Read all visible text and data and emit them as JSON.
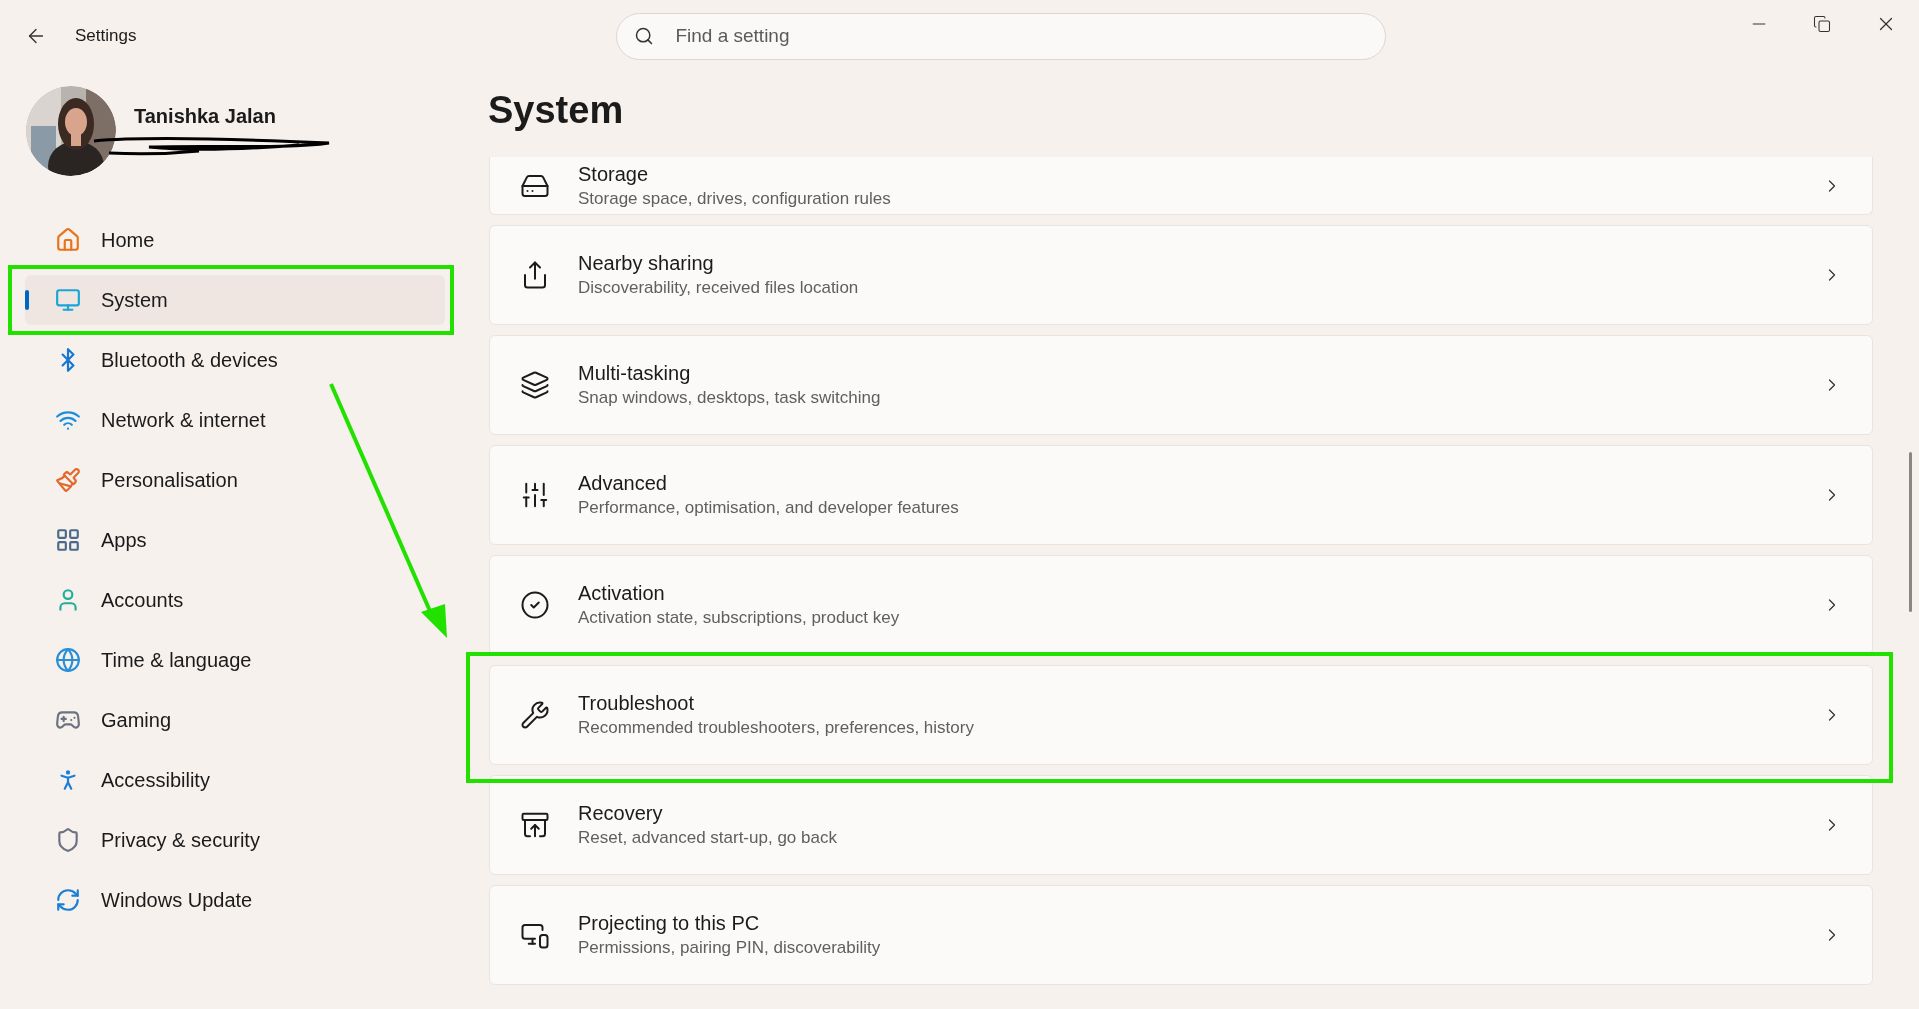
{
  "window": {
    "title": "Settings"
  },
  "search": {
    "placeholder": "Find a setting"
  },
  "account": {
    "name": "Tanishka Jalan"
  },
  "sidebar": {
    "items": [
      {
        "label": "Home",
        "kind": "home",
        "selected": false,
        "highlighted": false
      },
      {
        "label": "System",
        "kind": "system",
        "selected": true,
        "highlighted": true
      },
      {
        "label": "Bluetooth & devices",
        "kind": "bluetooth",
        "selected": false,
        "highlighted": false
      },
      {
        "label": "Network & internet",
        "kind": "wifi",
        "selected": false,
        "highlighted": false
      },
      {
        "label": "Personalisation",
        "kind": "brush",
        "selected": false,
        "highlighted": false
      },
      {
        "label": "Apps",
        "kind": "apps",
        "selected": false,
        "highlighted": false
      },
      {
        "label": "Accounts",
        "kind": "person",
        "selected": false,
        "highlighted": false
      },
      {
        "label": "Time & language",
        "kind": "globe",
        "selected": false,
        "highlighted": false
      },
      {
        "label": "Gaming",
        "kind": "gamepad",
        "selected": false,
        "highlighted": false
      },
      {
        "label": "Accessibility",
        "kind": "accessibility",
        "selected": false,
        "highlighted": false
      },
      {
        "label": "Privacy & security",
        "kind": "shield",
        "selected": false,
        "highlighted": false
      },
      {
        "label": "Windows Update",
        "kind": "update",
        "selected": false,
        "highlighted": false
      }
    ]
  },
  "page": {
    "title": "System"
  },
  "settings": [
    {
      "title": "Storage",
      "subtitle": "Storage space, drives, configuration rules",
      "kind": "drive",
      "highlighted": false
    },
    {
      "title": "Nearby sharing",
      "subtitle": "Discoverability, received files location",
      "kind": "share",
      "highlighted": false
    },
    {
      "title": "Multi-tasking",
      "subtitle": "Snap windows, desktops, task switching",
      "kind": "windows",
      "highlighted": false
    },
    {
      "title": "Advanced",
      "subtitle": "Performance, optimisation, and developer features",
      "kind": "tools",
      "highlighted": false
    },
    {
      "title": "Activation",
      "subtitle": "Activation state, subscriptions, product key",
      "kind": "check",
      "highlighted": false
    },
    {
      "title": "Troubleshoot",
      "subtitle": "Recommended troubleshooters, preferences, history",
      "kind": "wrench",
      "highlighted": true
    },
    {
      "title": "Recovery",
      "subtitle": "Reset, advanced start-up, go back",
      "kind": "recovery",
      "highlighted": false
    },
    {
      "title": "Projecting to this PC",
      "subtitle": "Permissions, pairing PIN, discoverability",
      "kind": "project",
      "highlighted": false
    }
  ]
}
